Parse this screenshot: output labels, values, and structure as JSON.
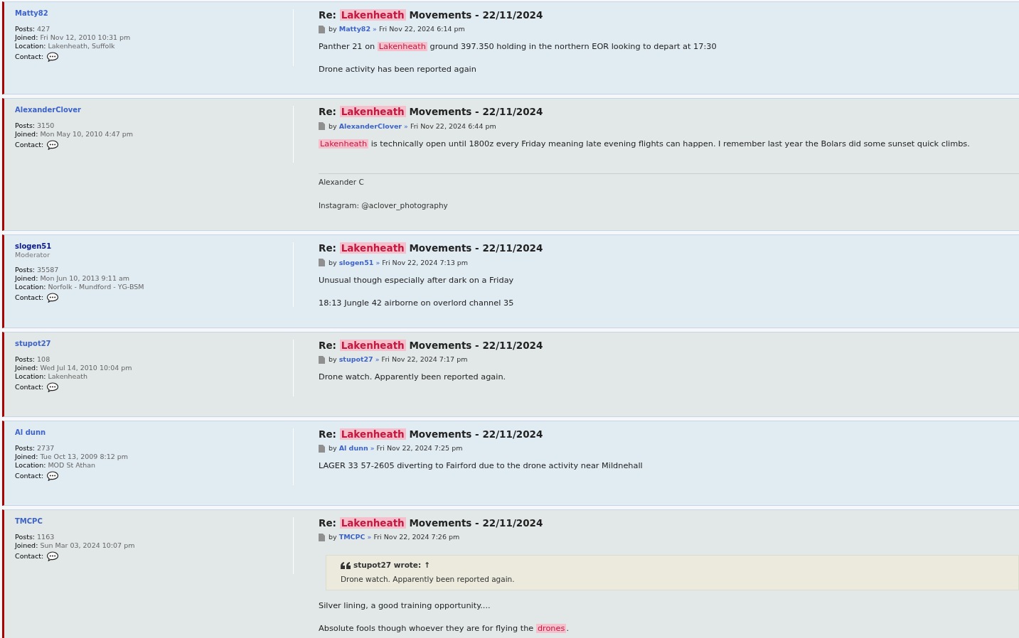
{
  "posts": [
    {
      "author": {
        "name": "Matty82",
        "color": "#3d63c9"
      },
      "profile": [
        {
          "label": "Posts:",
          "value": "427"
        },
        {
          "label": "Joined:",
          "value": "Fri Nov 12, 2010 10:31 pm"
        },
        {
          "label": "Location:",
          "value": "Lakenheath, Suffolk"
        }
      ],
      "contact": "Contact:",
      "title": [
        {
          "text": "Re: ",
          "highlight": false
        },
        {
          "text": "Lakenheath",
          "highlight": true
        },
        {
          "text": " Movements - 22/11/2024",
          "highlight": false
        }
      ],
      "meta": {
        "by": "by",
        "user": "Matty82",
        "sep": "»",
        "date": "Fri Nov 22, 2024 6:14 pm"
      },
      "body": [
        {
          "kind": "paragraph",
          "parts": [
            {
              "text": "Panther 21 on ",
              "highlight": false
            },
            {
              "text": "Lakenheath",
              "highlight": true
            },
            {
              "text": " ground 397.350 holding in the northern EOR looking to depart at 17:30",
              "highlight": false
            }
          ]
        },
        {
          "kind": "paragraph",
          "parts": [
            {
              "text": "Drone activity has been reported again",
              "highlight": false
            }
          ]
        }
      ]
    },
    {
      "author": {
        "name": "AlexanderClover",
        "color": "#3d63c9"
      },
      "profile": [
        {
          "label": "Posts:",
          "value": "3150"
        },
        {
          "label": "Joined:",
          "value": "Mon May 10, 2010 4:47 pm"
        }
      ],
      "contact": "Contact:",
      "title": [
        {
          "text": "Re: ",
          "highlight": false
        },
        {
          "text": "Lakenheath",
          "highlight": true
        },
        {
          "text": " Movements - 22/11/2024",
          "highlight": false
        }
      ],
      "meta": {
        "by": "by",
        "user": "AlexanderClover",
        "sep": "»",
        "date": "Fri Nov 22, 2024 6:44 pm"
      },
      "body": [
        {
          "kind": "paragraph",
          "parts": [
            {
              "text": "Lakenheath",
              "highlight": true
            },
            {
              "text": " is technically open until 1800z every Friday meaning late evening flights can happen. I remember last year the Bolars did some sunset quick climbs.",
              "highlight": false
            }
          ]
        }
      ],
      "signature": [
        "Alexander C",
        "Instagram: @aclover_photography"
      ]
    },
    {
      "author": {
        "name": "slogen51",
        "color": "#0b1a86",
        "rank": "Moderator"
      },
      "profile": [
        {
          "label": "Posts:",
          "value": "35587"
        },
        {
          "label": "Joined:",
          "value": "Mon Jun 10, 2013 9:11 am"
        },
        {
          "label": "Location:",
          "value": "Norfolk - Mundford - YG-BSM"
        }
      ],
      "contact": "Contact:",
      "title": [
        {
          "text": "Re: ",
          "highlight": false
        },
        {
          "text": "Lakenheath",
          "highlight": true
        },
        {
          "text": " Movements - 22/11/2024",
          "highlight": false
        }
      ],
      "meta": {
        "by": "by",
        "user": "slogen51",
        "sep": "»",
        "date": "Fri Nov 22, 2024 7:13 pm"
      },
      "body": [
        {
          "kind": "paragraph",
          "parts": [
            {
              "text": "Unusual though especially after dark on a Friday",
              "highlight": false
            }
          ]
        },
        {
          "kind": "paragraph",
          "parts": [
            {
              "text": "18:13 Jungle 42 airborne on overlord channel 35",
              "highlight": false
            }
          ]
        }
      ]
    },
    {
      "author": {
        "name": "stupot27",
        "color": "#3d63c9"
      },
      "profile": [
        {
          "label": "Posts:",
          "value": "108"
        },
        {
          "label": "Joined:",
          "value": "Wed Jul 14, 2010 10:04 pm"
        },
        {
          "label": "Location:",
          "value": "Lakenheath"
        }
      ],
      "contact": "Contact:",
      "title": [
        {
          "text": "Re: ",
          "highlight": false
        },
        {
          "text": "Lakenheath",
          "highlight": true
        },
        {
          "text": " Movements - 22/11/2024",
          "highlight": false
        }
      ],
      "meta": {
        "by": "by",
        "user": "stupot27",
        "sep": "»",
        "date": "Fri Nov 22, 2024 7:17 pm"
      },
      "body": [
        {
          "kind": "paragraph",
          "parts": [
            {
              "text": "Drone watch. Apparently been reported again.",
              "highlight": false
            }
          ]
        }
      ]
    },
    {
      "author": {
        "name": "Al dunn",
        "color": "#3d63c9"
      },
      "profile": [
        {
          "label": "Posts:",
          "value": "2737"
        },
        {
          "label": "Joined:",
          "value": "Tue Oct 13, 2009 8:12 pm"
        },
        {
          "label": "Location:",
          "value": "MOD St Athan"
        }
      ],
      "contact": "Contact:",
      "title": [
        {
          "text": "Re: ",
          "highlight": false
        },
        {
          "text": "Lakenheath",
          "highlight": true
        },
        {
          "text": " Movements - 22/11/2024",
          "highlight": false
        }
      ],
      "meta": {
        "by": "by",
        "user": "Al dunn",
        "sep": "»",
        "date": "Fri Nov 22, 2024 7:25 pm"
      },
      "body": [
        {
          "kind": "paragraph",
          "parts": [
            {
              "text": "LAGER 33 57-2605 diverting to Fairford due to the drone activity near Mildnehall",
              "highlight": false
            }
          ]
        }
      ]
    },
    {
      "author": {
        "name": "TMCPC",
        "color": "#3d63c9"
      },
      "profile": [
        {
          "label": "Posts:",
          "value": "1163"
        },
        {
          "label": "Joined:",
          "value": "Sun Mar 03, 2024 10:07 pm"
        }
      ],
      "contact": "Contact:",
      "title": [
        {
          "text": "Re: ",
          "highlight": false
        },
        {
          "text": "Lakenheath",
          "highlight": true
        },
        {
          "text": " Movements - 22/11/2024",
          "highlight": false
        }
      ],
      "meta": {
        "by": "by",
        "user": "TMCPC",
        "sep": "»",
        "date": "Fri Nov 22, 2024 7:26 pm"
      },
      "body": [
        {
          "kind": "quote",
          "cite": "stupot27 wrote:",
          "arrow": "↑",
          "text": "Drone watch. Apparently been reported again."
        },
        {
          "kind": "paragraph",
          "parts": [
            {
              "text": "Silver lining, a good training opportunity....",
              "highlight": false
            }
          ]
        },
        {
          "kind": "paragraph",
          "parts": [
            {
              "text": "Absolute fools though whoever they are for flying the ",
              "highlight": false
            },
            {
              "text": "drones",
              "highlight": true
            },
            {
              "text": ".",
              "highlight": false
            }
          ]
        }
      ]
    }
  ]
}
